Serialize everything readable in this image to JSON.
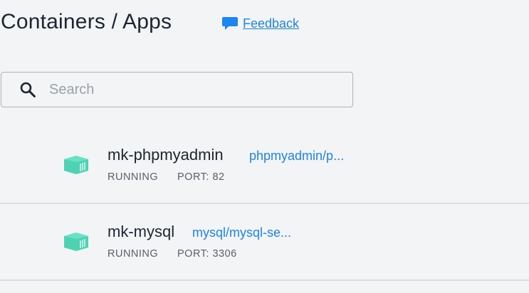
{
  "header": {
    "title": "Containers / Apps",
    "feedback_label": "Feedback"
  },
  "search": {
    "placeholder": "Search",
    "value": ""
  },
  "containers": [
    {
      "name": "mk-phpmyadmin",
      "image": "phpmyadmin/p...",
      "status": "RUNNING",
      "port": "PORT: 82"
    },
    {
      "name": "mk-mysql",
      "image": "mysql/mysql-se...",
      "status": "RUNNING",
      "port": "PORT: 3306"
    }
  ],
  "colors": {
    "accent": "#1d84f0",
    "container_icon": "#4fd1b3",
    "background": "#f3f4f6"
  },
  "icons": {
    "feedback": "speech-bubble-icon",
    "search": "search-icon",
    "container": "container-icon"
  }
}
